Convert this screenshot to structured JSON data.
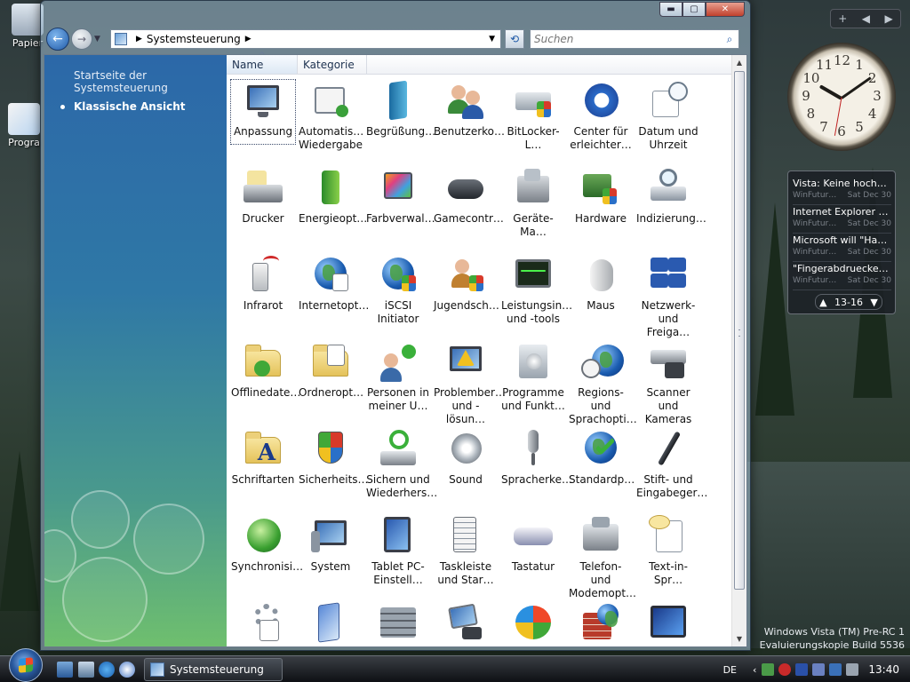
{
  "desktop": {
    "icons": [
      {
        "label": "Papier"
      },
      {
        "label": "Progra"
      }
    ],
    "watermark": {
      "line1": "Windows Vista (TM) Pre-RC 1",
      "line2": "Evaluierungskopie Build 5536"
    }
  },
  "window": {
    "minimize_glyph": "▬",
    "maximize_glyph": "▢",
    "close_glyph": "✕",
    "address": {
      "crumb": "Systemsteuerung"
    },
    "search": {
      "placeholder": "Suchen"
    },
    "sidebar": {
      "links": [
        {
          "label": "Startseite der Systemsteuerung"
        },
        {
          "label": "Klassische Ansicht"
        }
      ]
    },
    "columns": {
      "name": "Name",
      "category": "Kategorie"
    },
    "items": [
      {
        "label": "Anpassung"
      },
      {
        "label": "Automatis… Wiedergabe"
      },
      {
        "label": "Begrüßung…"
      },
      {
        "label": "Benutzerko…"
      },
      {
        "label": "BitLocker-L…"
      },
      {
        "label": "Center für erleichter…"
      },
      {
        "label": "Datum und Uhrzeit"
      },
      {
        "label": "Drucker"
      },
      {
        "label": "Energieopt…"
      },
      {
        "label": "Farbverwal…"
      },
      {
        "label": "Gamecontr…"
      },
      {
        "label": "Geräte-Ma…"
      },
      {
        "label": "Hardware"
      },
      {
        "label": "Indizierung…"
      },
      {
        "label": "Infrarot"
      },
      {
        "label": "Internetopt…"
      },
      {
        "label": "iSCSI Initiator"
      },
      {
        "label": "Jugendsch…"
      },
      {
        "label": "Leistungsin… und -tools"
      },
      {
        "label": "Maus"
      },
      {
        "label": "Netzwerk- und Freiga…"
      },
      {
        "label": "Offlinedate…"
      },
      {
        "label": "Ordneropt…"
      },
      {
        "label": "Personen in meiner U…"
      },
      {
        "label": "Problember… und -lösun…"
      },
      {
        "label": "Programme und Funkt…"
      },
      {
        "label": "Regions- und Sprachopti…"
      },
      {
        "label": "Scanner und Kameras"
      },
      {
        "label": "Schriftarten"
      },
      {
        "label": "Sicherheits…"
      },
      {
        "label": "Sichern und Wiederhers…"
      },
      {
        "label": "Sound"
      },
      {
        "label": "Spracherke…"
      },
      {
        "label": "Standardp…"
      },
      {
        "label": "Stift- und Eingabeger…"
      },
      {
        "label": "Synchronisi…"
      },
      {
        "label": "System"
      },
      {
        "label": "Tablet PC-Einstell…"
      },
      {
        "label": "Taskleiste und Star…"
      },
      {
        "label": "Tastatur"
      },
      {
        "label": "Telefon- und Modemopt…"
      },
      {
        "label": "Text-in-Spr…"
      },
      {
        "label": ""
      },
      {
        "label": ""
      },
      {
        "label": ""
      },
      {
        "label": ""
      },
      {
        "label": ""
      },
      {
        "label": ""
      },
      {
        "label": ""
      }
    ]
  },
  "taskbar": {
    "task_button": "Systemsteuerung",
    "language": "DE",
    "time": "13:40"
  },
  "gadgets": {
    "feed": {
      "items": [
        {
          "title": "Vista: Keine hochau…",
          "source": "WinFutur…",
          "date": "Sat Dec 30"
        },
        {
          "title": "Internet Explorer 7 …",
          "source": "WinFutur…",
          "date": "Sat Dec 30"
        },
        {
          "title": "Microsoft will \"Hae…",
          "source": "WinFutur…",
          "date": "Sat Dec 30"
        },
        {
          "title": "\"Fingerabdruecke\" …",
          "source": "WinFutur…",
          "date": "Sat Dec 30"
        }
      ],
      "pager": "13-16"
    },
    "clock_numbers": [
      "12",
      "1",
      "2",
      "3",
      "4",
      "5",
      "6",
      "7",
      "8",
      "9",
      "10",
      "11"
    ]
  }
}
